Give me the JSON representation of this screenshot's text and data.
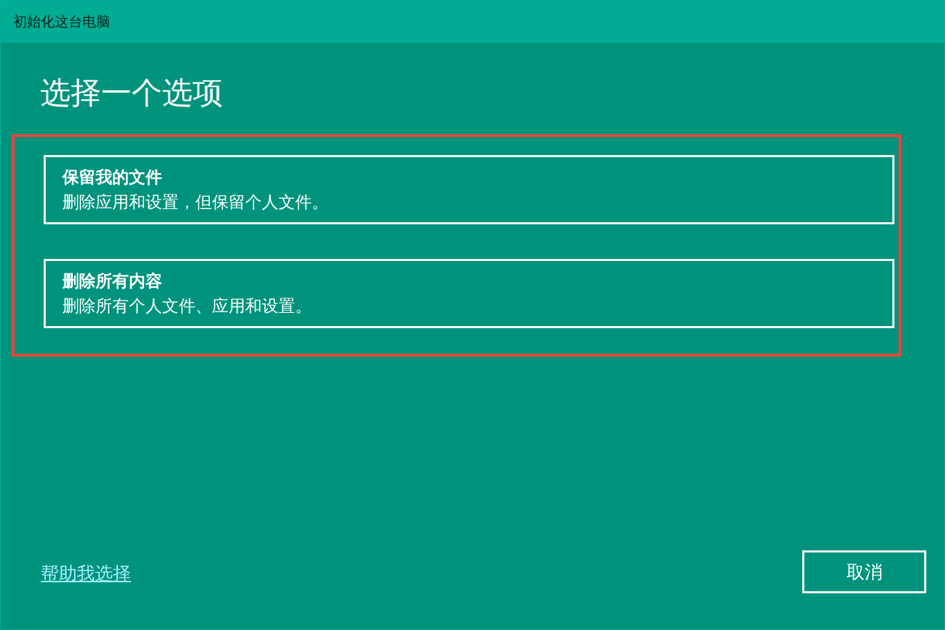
{
  "window": {
    "title": "初始化这台电脑"
  },
  "heading": "选择一个选项",
  "options_highlighted": true,
  "options": [
    {
      "title": "保留我的文件",
      "description": "删除应用和设置，但保留个人文件。"
    },
    {
      "title": "删除所有内容",
      "description": "删除所有个人文件、应用和设置。"
    }
  ],
  "help_link": "帮助我选择",
  "buttons": [
    "取消"
  ]
}
